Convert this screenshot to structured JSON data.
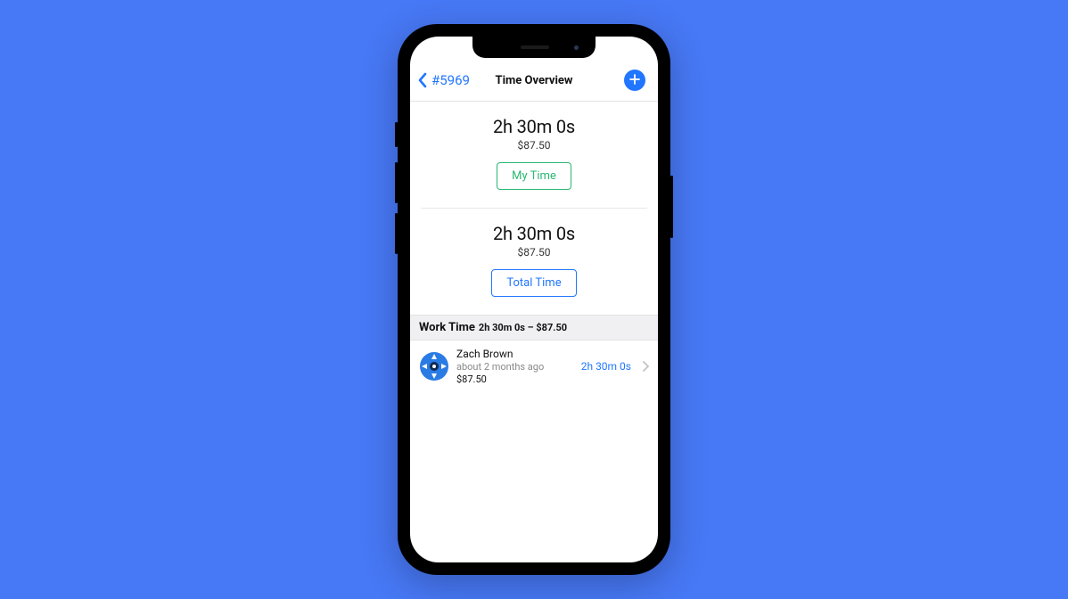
{
  "header": {
    "back_label": "#5969",
    "title": "Time Overview"
  },
  "my_time": {
    "duration": "2h 30m 0s",
    "amount": "$87.50",
    "button_label": "My Time"
  },
  "total_time": {
    "duration": "2h 30m 0s",
    "amount": "$87.50",
    "button_label": "Total Time"
  },
  "work_section": {
    "label": "Work Time",
    "detail": "2h 30m 0s – $87.50"
  },
  "entries": [
    {
      "name": "Zach Brown",
      "timestamp": "about 2 months ago",
      "amount": "$87.50",
      "duration": "2h 30m 0s"
    }
  ],
  "icons": {
    "back": "chevron-left",
    "add": "plus",
    "row_disclosure": "chevron-right"
  },
  "colors": {
    "accent_blue": "#2176ff",
    "accent_green": "#2bb673",
    "background": "#4778f5"
  }
}
